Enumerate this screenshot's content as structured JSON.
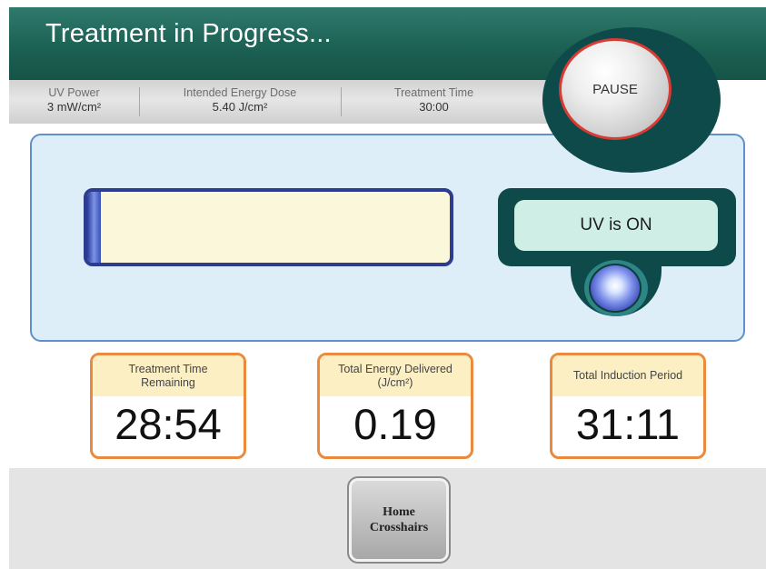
{
  "header": {
    "title": "Treatment in Progress..."
  },
  "info": {
    "uv_power_label": "UV Power",
    "uv_power_value": "3 mW/cm²",
    "energy_label": "Intended Energy Dose",
    "energy_value": "5.40 J/cm²",
    "time_label": "Treatment Time",
    "time_value": "30:00"
  },
  "pause_button": {
    "label": "PAUSE"
  },
  "progress": {
    "fraction": 0.0367
  },
  "uv_status": {
    "text": "UV is ON"
  },
  "readouts": [
    {
      "label": "Treatment Time Remaining",
      "value": "28:54"
    },
    {
      "label": "Total Energy Delivered (J/cm²)",
      "value": "0.19"
    },
    {
      "label": "Total Induction Period",
      "value": "31:11"
    }
  ],
  "footer": {
    "home_button_label": "Home Crosshairs"
  },
  "colors": {
    "header": "#1c6154",
    "accent_orange": "#eb8a3d",
    "pause_ring": "#d83b34",
    "panel": "#ddeef8"
  }
}
